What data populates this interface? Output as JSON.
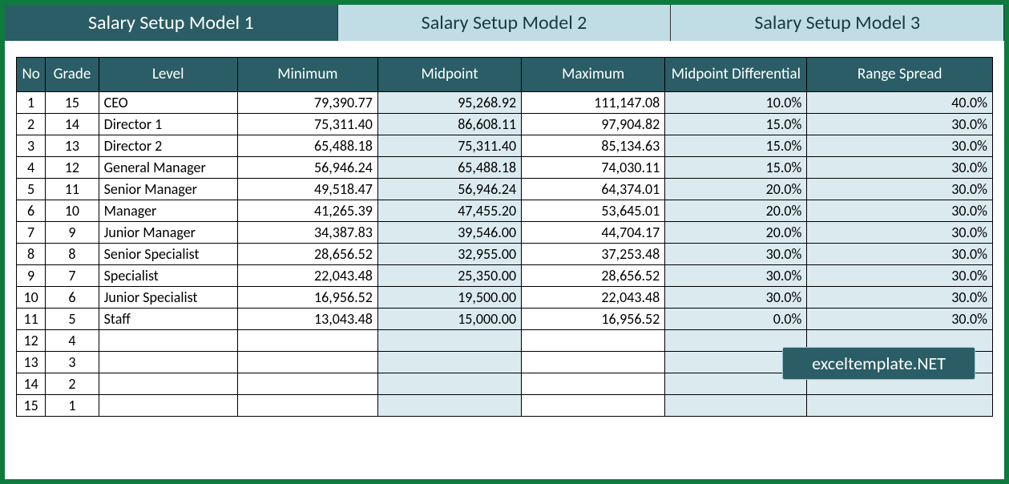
{
  "tabs": {
    "t1": "Salary Setup Model 1",
    "t2": "Salary Setup Model 2",
    "t3": "Salary Setup Model 3"
  },
  "headers": {
    "no": "No",
    "grade": "Grade",
    "level": "Level",
    "min": "Minimum",
    "mid": "Midpoint",
    "max": "Maximum",
    "diff": "Midpoint Differential",
    "spread": "Range Spread"
  },
  "rows": [
    {
      "no": "1",
      "grade": "15",
      "level": "CEO",
      "min": "79,390.77",
      "mid": "95,268.92",
      "max": "111,147.08",
      "diff": "10.0%",
      "spread": "40.0%"
    },
    {
      "no": "2",
      "grade": "14",
      "level": "Director 1",
      "min": "75,311.40",
      "mid": "86,608.11",
      "max": "97,904.82",
      "diff": "15.0%",
      "spread": "30.0%"
    },
    {
      "no": "3",
      "grade": "13",
      "level": "Director 2",
      "min": "65,488.18",
      "mid": "75,311.40",
      "max": "85,134.63",
      "diff": "15.0%",
      "spread": "30.0%"
    },
    {
      "no": "4",
      "grade": "12",
      "level": "General Manager",
      "min": "56,946.24",
      "mid": "65,488.18",
      "max": "74,030.11",
      "diff": "15.0%",
      "spread": "30.0%"
    },
    {
      "no": "5",
      "grade": "11",
      "level": "Senior Manager",
      "min": "49,518.47",
      "mid": "56,946.24",
      "max": "64,374.01",
      "diff": "20.0%",
      "spread": "30.0%"
    },
    {
      "no": "6",
      "grade": "10",
      "level": "Manager",
      "min": "41,265.39",
      "mid": "47,455.20",
      "max": "53,645.01",
      "diff": "20.0%",
      "spread": "30.0%"
    },
    {
      "no": "7",
      "grade": "9",
      "level": "Junior Manager",
      "min": "34,387.83",
      "mid": "39,546.00",
      "max": "44,704.17",
      "diff": "20.0%",
      "spread": "30.0%"
    },
    {
      "no": "8",
      "grade": "8",
      "level": "Senior Specialist",
      "min": "28,656.52",
      "mid": "32,955.00",
      "max": "37,253.48",
      "diff": "30.0%",
      "spread": "30.0%"
    },
    {
      "no": "9",
      "grade": "7",
      "level": "Specialist",
      "min": "22,043.48",
      "mid": "25,350.00",
      "max": "28,656.52",
      "diff": "30.0%",
      "spread": "30.0%"
    },
    {
      "no": "10",
      "grade": "6",
      "level": "Junior Specialist",
      "min": "16,956.52",
      "mid": "19,500.00",
      "max": "22,043.48",
      "diff": "30.0%",
      "spread": "30.0%"
    },
    {
      "no": "11",
      "grade": "5",
      "level": "Staff",
      "min": "13,043.48",
      "mid": "15,000.00",
      "max": "16,956.52",
      "diff": "0.0%",
      "spread": "30.0%"
    },
    {
      "no": "12",
      "grade": "4",
      "level": "",
      "min": "",
      "mid": "",
      "max": "",
      "diff": "",
      "spread": ""
    },
    {
      "no": "13",
      "grade": "3",
      "level": "",
      "min": "",
      "mid": "",
      "max": "",
      "diff": "",
      "spread": ""
    },
    {
      "no": "14",
      "grade": "2",
      "level": "",
      "min": "",
      "mid": "",
      "max": "",
      "diff": "",
      "spread": ""
    },
    {
      "no": "15",
      "grade": "1",
      "level": "",
      "min": "",
      "mid": "",
      "max": "",
      "diff": "",
      "spread": ""
    }
  ],
  "watermark": "exceltemplate.NET"
}
